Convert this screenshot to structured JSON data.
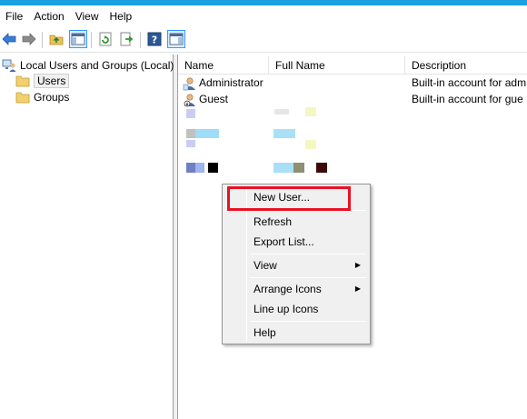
{
  "menubar": {
    "items": [
      "File",
      "Action",
      "View",
      "Help"
    ]
  },
  "toolbar": {
    "buttons": [
      "back-arrow-icon",
      "forward-arrow-icon",
      "up-folder-icon",
      "show-hide-tree-icon",
      "refresh-icon",
      "export-list-icon",
      "help-icon",
      "show-hide-action-pane-icon"
    ]
  },
  "tree": {
    "root": "Local Users and Groups (Local)",
    "children": [
      "Users",
      "Groups"
    ]
  },
  "list": {
    "columns": [
      "Name",
      "Full Name",
      "Description"
    ],
    "rows": [
      {
        "name": "Administrator",
        "full_name": "",
        "description": "Built-in account for adm"
      },
      {
        "name": "Guest",
        "full_name": "",
        "description": "Built-in account for gue"
      }
    ]
  },
  "context_menu": {
    "items": [
      {
        "label": "New User...",
        "submenu": false,
        "highlighted": true
      },
      {
        "label": "Refresh",
        "submenu": false
      },
      {
        "label": "Export List...",
        "submenu": false
      },
      {
        "label": "View",
        "submenu": true
      },
      {
        "label": "Arrange Icons",
        "submenu": true
      },
      {
        "label": "Line up Icons",
        "submenu": false
      },
      {
        "label": "Help",
        "submenu": false
      }
    ],
    "submenu_glyph": "▶"
  },
  "colors": {
    "title_bar": "#1ba1e2",
    "highlight_box": "#e81123",
    "menu_background": "#f0f0f0"
  }
}
